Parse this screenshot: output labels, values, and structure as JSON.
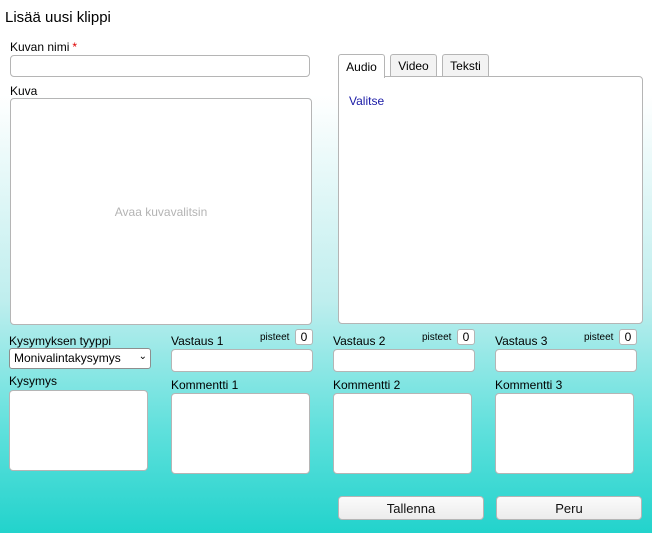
{
  "dialog": {
    "title": "Lisää uusi klippi"
  },
  "name_field": {
    "label": "Kuvan nimi",
    "required_mark": "*",
    "value": ""
  },
  "image_field": {
    "label": "Kuva",
    "placeholder": "Avaa kuvavalitsin"
  },
  "tabs": [
    {
      "label": "Audio",
      "active": true
    },
    {
      "label": "Video",
      "active": false
    },
    {
      "label": "Teksti",
      "active": false
    }
  ],
  "tab_panel": {
    "link": "Valitse"
  },
  "question_type": {
    "label": "Kysymyksen tyyppi",
    "selected": "Monivalintakysymys"
  },
  "question": {
    "label": "Kysymys",
    "value": ""
  },
  "answers": [
    {
      "label": "Vastaus 1",
      "points_label": "pisteet",
      "points": "0",
      "comment_label": "Kommentti 1"
    },
    {
      "label": "Vastaus 2",
      "points_label": "pisteet",
      "points": "0",
      "comment_label": "Kommentti 2"
    },
    {
      "label": "Vastaus 3",
      "points_label": "pisteet",
      "points": "0",
      "comment_label": "Kommentti 3"
    }
  ],
  "buttons": {
    "save": "Tallenna",
    "cancel": "Peru"
  }
}
